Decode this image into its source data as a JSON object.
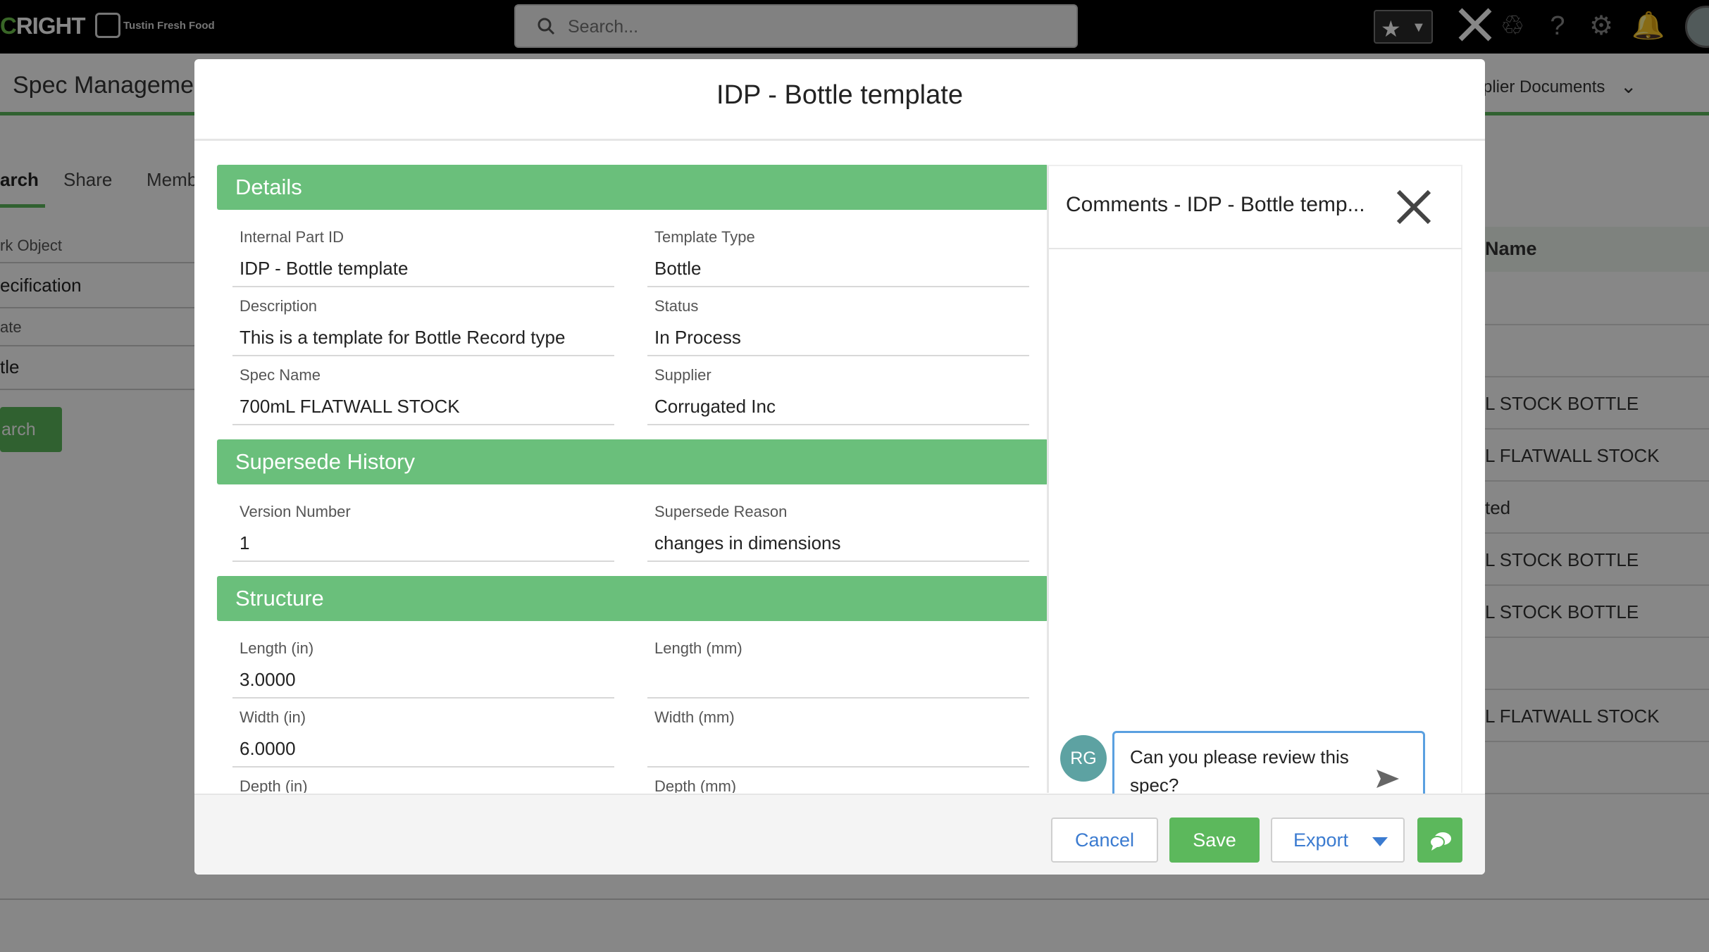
{
  "app": {
    "brand": "CRIGHT",
    "brand_accent": "C",
    "brand_rest": "RIGHT",
    "customer_name": "Tustin Fresh Food",
    "search_placeholder": "Search...",
    "page_title": "Spec Manageme",
    "right_nav": "plier Documents",
    "colors": {
      "accent": "#5cb85c",
      "section": "#6abf7b",
      "link": "#3b7bd0"
    }
  },
  "background": {
    "tabs": [
      "arch",
      "Share",
      "Memb"
    ],
    "fields": [
      {
        "label": "rk Object",
        "value": "ecification"
      },
      {
        "label": "ate",
        "value": "tle"
      }
    ],
    "search_button": "arch",
    "table_header": "Name",
    "table_rows": [
      "",
      "",
      "L STOCK BOTTLE",
      "L FLATWALL STOCK",
      "ted",
      "L STOCK BOTTLE",
      "L STOCK BOTTLE",
      "",
      "L FLATWALL STOCK",
      ""
    ]
  },
  "modal": {
    "title": "IDP - Bottle template",
    "sections": {
      "details": {
        "title": "Details",
        "fields": [
          {
            "label": "Internal Part ID",
            "value": "IDP - Bottle template"
          },
          {
            "label": "Template Type",
            "value": "Bottle"
          },
          {
            "label": "Description",
            "value": "This is a template for Bottle Record type"
          },
          {
            "label": "Status",
            "value": "In Process"
          },
          {
            "label": "Spec Name",
            "value": "700mL FLATWALL STOCK"
          },
          {
            "label": "Supplier",
            "value": "Corrugated Inc"
          }
        ]
      },
      "supersede": {
        "title": "Supersede History",
        "fields": [
          {
            "label": "Version Number",
            "value": "1"
          },
          {
            "label": "Supersede Reason",
            "value": "changes in dimensions"
          }
        ]
      },
      "structure": {
        "title": "Structure",
        "fields": [
          {
            "label": "Length (in)",
            "value": "3.0000"
          },
          {
            "label": "Length (mm)",
            "value": ""
          },
          {
            "label": "Width (in)",
            "value": "6.0000"
          },
          {
            "label": "Width (mm)",
            "value": ""
          },
          {
            "label": "Depth (in)",
            "value": ""
          },
          {
            "label": "Depth (mm)",
            "value": ""
          }
        ]
      }
    },
    "comments": {
      "title": "Comments - IDP - Bottle temp...",
      "avatar_initials": "RG",
      "draft": "Can you please review this spec?"
    },
    "footer": {
      "cancel": "Cancel",
      "save": "Save",
      "export": "Export"
    }
  }
}
